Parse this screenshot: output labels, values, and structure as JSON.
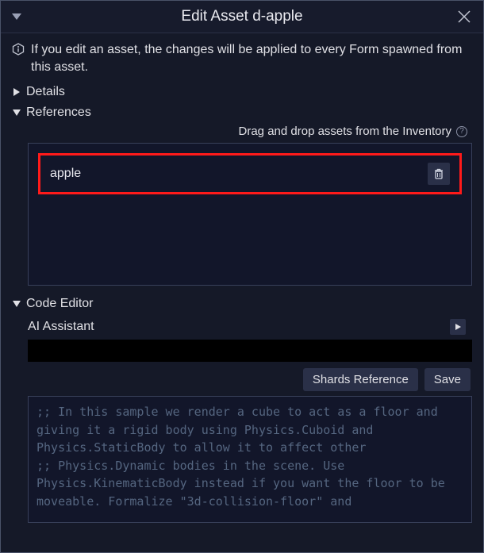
{
  "titlebar": {
    "title": "Edit Asset d-apple"
  },
  "info": {
    "text": "If you edit an asset, the changes will be applied to every Form spawned from this asset."
  },
  "sections": {
    "details": {
      "label": "Details",
      "expanded": false
    },
    "references": {
      "label": "References",
      "expanded": true,
      "hint": "Drag and drop assets from the Inventory",
      "items": [
        {
          "name": "apple"
        }
      ]
    },
    "code_editor": {
      "label": "Code Editor",
      "expanded": true,
      "ai_label": "AI Assistant",
      "buttons": {
        "shards_ref": "Shards Reference",
        "save": "Save"
      },
      "code": ";; In this sample we render a cube to act as a floor and giving it a rigid body using Physics.Cuboid and Physics.StaticBody to allow it to affect other\n;; Physics.Dynamic bodies in the scene. Use Physics.KinematicBody instead if you want the floor to be moveable. Formalize \"3d-collision-floor\" and"
    }
  }
}
